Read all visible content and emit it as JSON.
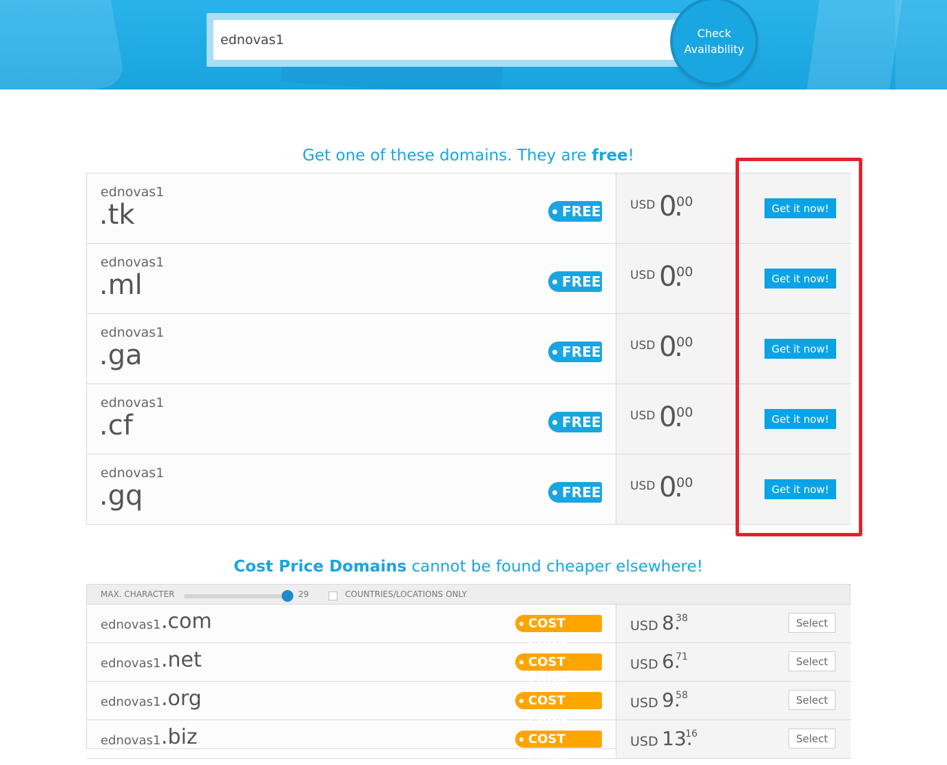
{
  "search": {
    "value": "ednovas1",
    "button_label": "Check\nAvailability"
  },
  "free_section": {
    "heading_prefix": "Get one of these domains. They are ",
    "heading_bold": "free",
    "heading_suffix": "!",
    "rows": [
      {
        "name": "ednovas1",
        "tld": ".tk",
        "badge": "FREE",
        "currency": "USD",
        "price_int": "0",
        "price_dec": "00",
        "button": "Get it now!"
      },
      {
        "name": "ednovas1",
        "tld": ".ml",
        "badge": "FREE",
        "currency": "USD",
        "price_int": "0",
        "price_dec": "00",
        "button": "Get it now!"
      },
      {
        "name": "ednovas1",
        "tld": ".ga",
        "badge": "FREE",
        "currency": "USD",
        "price_int": "0",
        "price_dec": "00",
        "button": "Get it now!"
      },
      {
        "name": "ednovas1",
        "tld": ".cf",
        "badge": "FREE",
        "currency": "USD",
        "price_int": "0",
        "price_dec": "00",
        "button": "Get it now!"
      },
      {
        "name": "ednovas1",
        "tld": ".gq",
        "badge": "FREE",
        "currency": "USD",
        "price_int": "0",
        "price_dec": "00",
        "button": "Get it now!"
      }
    ]
  },
  "cost_section": {
    "heading_bold": "Cost Price Domains",
    "heading_rest": " cannot be found cheaper elsewhere!",
    "filter": {
      "max_char_label": "MAX. CHARACTER",
      "max_char_value": "29",
      "countries_label": "COUNTRIES/LOCATIONS ONLY"
    },
    "rows": [
      {
        "name": "ednovas1",
        "tld": ".com",
        "badge": "COST PRICE",
        "currency": "USD",
        "price_int": "8.",
        "price_dec": "38",
        "button": "Select"
      },
      {
        "name": "ednovas1",
        "tld": ".net",
        "badge": "COST PRICE",
        "currency": "USD",
        "price_int": "6.",
        "price_dec": "71",
        "button": "Select"
      },
      {
        "name": "ednovas1",
        "tld": ".org",
        "badge": "COST PRICE",
        "currency": "USD",
        "price_int": "9.",
        "price_dec": "58",
        "button": "Select"
      },
      {
        "name": "ednovas1",
        "tld": ".biz",
        "badge": "COST PRICE",
        "currency": "USD",
        "price_int": "13.",
        "price_dec": "16",
        "button": "Select"
      }
    ]
  },
  "colors": {
    "accent": "#1aa5e0",
    "cost_badge": "#ffa500",
    "highlight_box": "#e8202a"
  }
}
